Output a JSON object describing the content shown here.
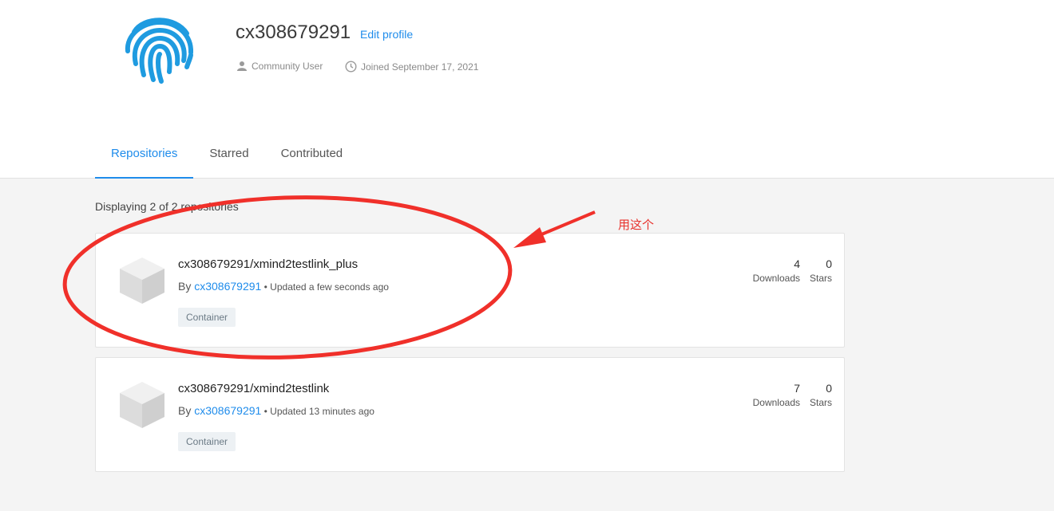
{
  "profile": {
    "username": "cx308679291",
    "edit_label": "Edit profile",
    "role": "Community User",
    "joined": "Joined September 17, 2021",
    "avatar_icon": "fingerprint-icon",
    "accent_color": "#1f8ceb"
  },
  "tabs": [
    {
      "label": "Repositories",
      "active": true
    },
    {
      "label": "Starred",
      "active": false
    },
    {
      "label": "Contributed",
      "active": false
    }
  ],
  "count_label": "Displaying 2 of 2 repositories",
  "repos": [
    {
      "name": "cx308679291/xmind2testlink_plus",
      "by_prefix": "By ",
      "owner": "cx308679291",
      "updated": " • Updated a few seconds ago",
      "badge": "Container",
      "downloads": "4",
      "downloads_label": "Downloads",
      "stars": "0",
      "stars_label": "Stars"
    },
    {
      "name": "cx308679291/xmind2testlink",
      "by_prefix": "By ",
      "owner": "cx308679291",
      "updated": " • Updated 13 minutes ago",
      "badge": "Container",
      "downloads": "7",
      "downloads_label": "Downloads",
      "stars": "0",
      "stars_label": "Stars"
    }
  ],
  "annotation": {
    "text": "用这个",
    "color": "#e8322c"
  }
}
